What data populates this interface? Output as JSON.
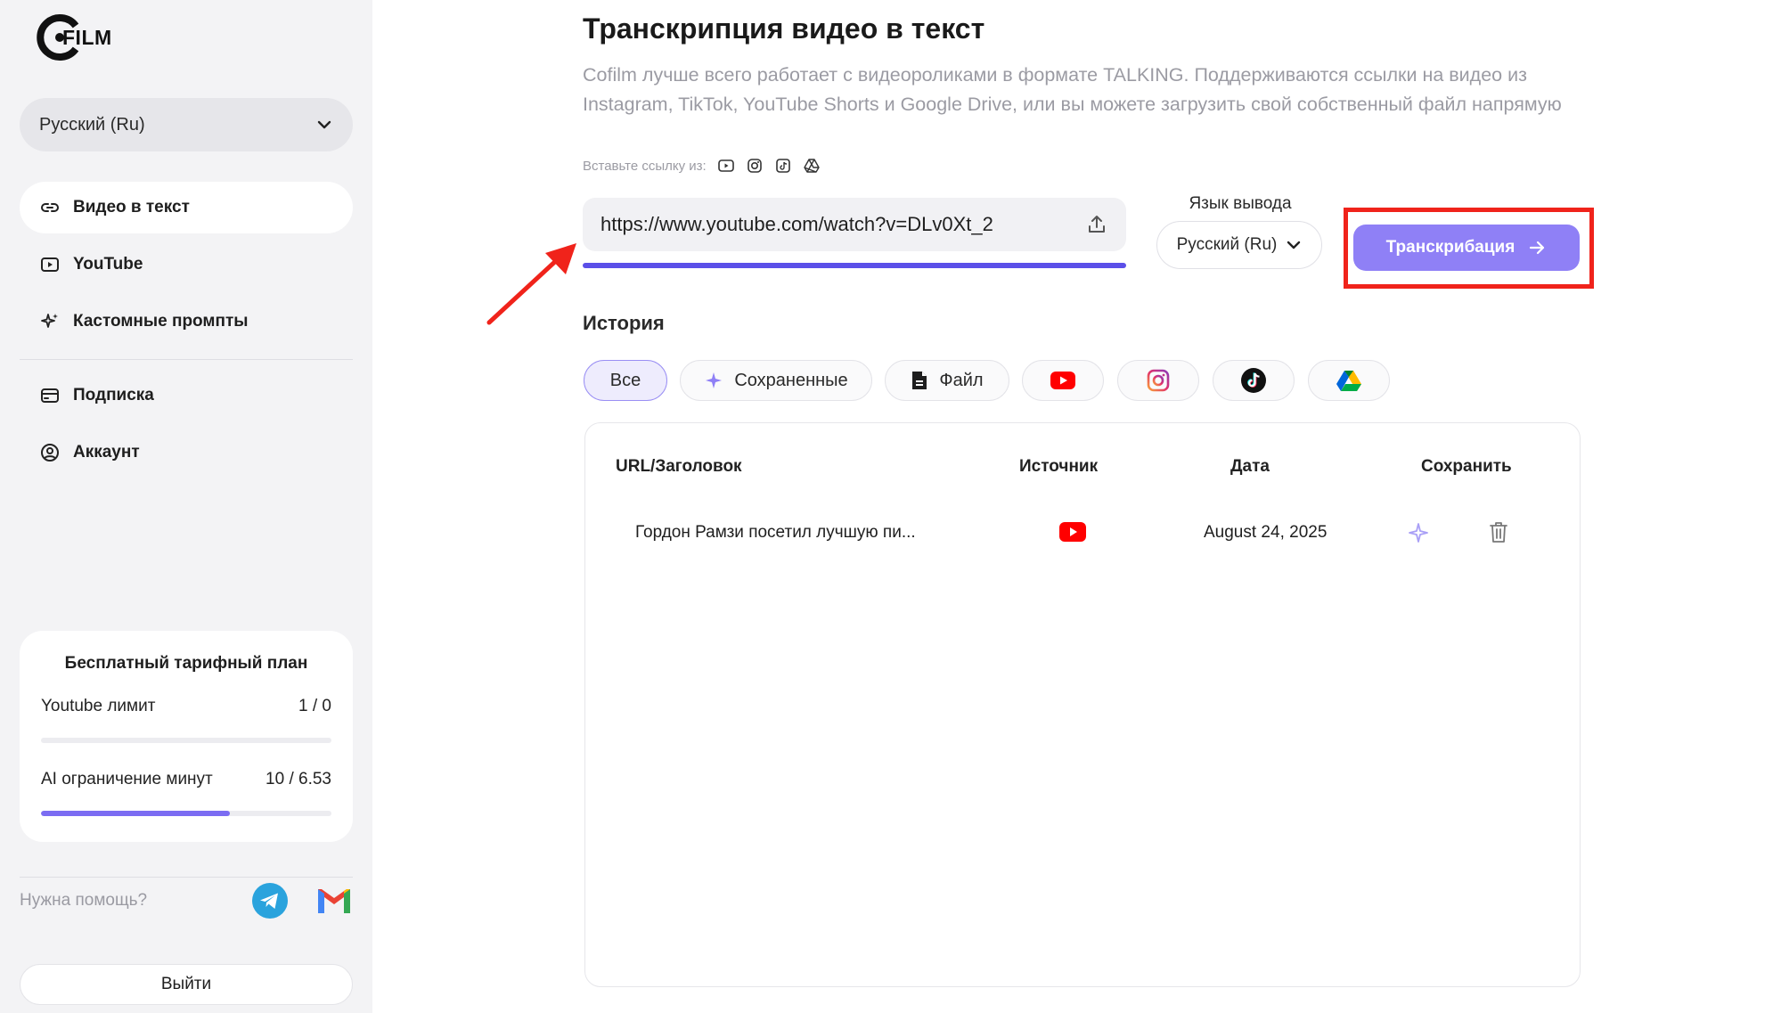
{
  "brand": {
    "name": "FILM"
  },
  "sidebar": {
    "language": "Русский (Ru)",
    "nav": [
      {
        "label": "Видео в текст",
        "icon": "link-icon"
      },
      {
        "label": "YouTube",
        "icon": "play-square-icon"
      },
      {
        "label": "Кастомные промпты",
        "icon": "sparkles-icon"
      },
      {
        "label": "Подписка",
        "icon": "card-icon"
      },
      {
        "label": "Аккаунт",
        "icon": "user-circle-icon"
      }
    ],
    "plan": {
      "title": "Бесплатный тарифный план",
      "youtube_label": "Youtube лимит",
      "youtube_value": "1 / 0",
      "youtube_progress": 0,
      "ai_label": "AI ограничение минут",
      "ai_value": "10 / 6.53",
      "ai_progress": 0.65
    },
    "help": "Нужна помощь?",
    "logout": "Выйти"
  },
  "main": {
    "title": "Транскрипция видео в текст",
    "description": "Cofilm лучше всего работает с видеороликами в формате TALKING. Поддерживаются ссылки на видео из Instagram, TikTok, YouTube Shorts и Google Drive, или вы можете загрузить свой собственный файл напрямую",
    "paste_label": "Вставьте ссылку из:",
    "url_value": "https://www.youtube.com/watch?v=DLv0Xt_2",
    "output_language_label": "Язык вывода",
    "output_language": "Русский (Ru)",
    "transcribe_button": "Транскрибация",
    "history_title": "История",
    "filters": [
      {
        "label": "Все"
      },
      {
        "label": "Сохраненные"
      },
      {
        "label": "Файл"
      }
    ],
    "table": {
      "headers": [
        "URL/Заголовок",
        "Источник",
        "Дата",
        "Сохранить"
      ],
      "rows": [
        {
          "title": "Гордон Рамзи посетил лучшую пи...",
          "source": "youtube-icon",
          "date": "August 24, 2025"
        }
      ]
    }
  },
  "colors": {
    "accent": "#5b4fe8",
    "button": "#8f80f6",
    "annotation_red": "#f0231b",
    "youtube_red": "#ff0000"
  }
}
